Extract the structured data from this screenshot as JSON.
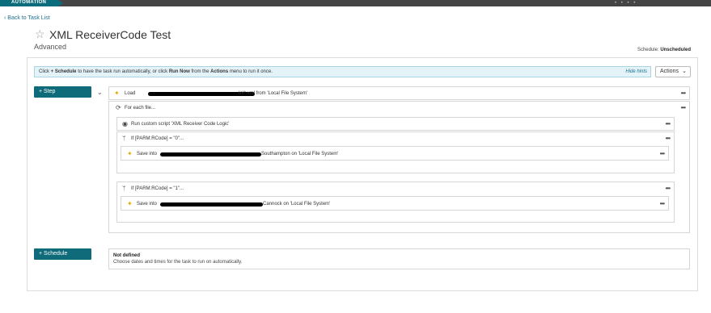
{
  "topbar": {
    "tab_label": "AUTOMATION",
    "right_dots": "• • • •"
  },
  "nav": {
    "back_label": "Back to Task List"
  },
  "task": {
    "title": "XML ReceiverCode Test",
    "subtitle": "Advanced"
  },
  "schedule_status": {
    "label": "Schedule:",
    "value": "Unscheduled"
  },
  "hint": {
    "part1": "Click ",
    "bold1": "+ Schedule",
    "part2": " to have the task run automatically, or click ",
    "bold2": "Run Now",
    "part3": " from the ",
    "bold3": "Actions",
    "part4": " menu to run it once.",
    "hide_label": "Hide hints"
  },
  "actions_button": {
    "label": "Actions"
  },
  "step_button": {
    "label": "+ Step"
  },
  "schedule_button": {
    "label": "+ Schedule"
  },
  "steps": {
    "load": {
      "prefix": "Load",
      "suffix": "In\\*.xml from 'Local File System'"
    },
    "foreach": {
      "label": "For each file..."
    },
    "run_script": {
      "label": "Run custom script 'XML Receiver Code Logic'"
    },
    "if0": {
      "label": "If [PARM:RCode] = \"0\"..."
    },
    "save0": {
      "prefix": "Save into",
      "suffix": "Southampton on 'Local File System'"
    },
    "if1": {
      "label": "If [PARM:RCode] = \"1\"..."
    },
    "save1": {
      "prefix": "Save into",
      "suffix": "Cannock on 'Local File System'"
    },
    "more_label": "•••"
  },
  "schedule_panel": {
    "title": "Not defined",
    "description": "Choose dates and times for the task to run on automatically."
  },
  "icons": {
    "back": "chevron-left-icon",
    "star": "star-outline-icon",
    "load": "arrow-up-icon",
    "loop": "loop-icon",
    "run": "play-circle-icon",
    "branch": "branch-icon",
    "save": "arrow-up-icon",
    "collapse": "chevron-down-icon"
  },
  "colors": {
    "accent": "#0f6a7a",
    "link": "#1f6f8b",
    "hint_bg": "#e3f3f8",
    "topbar": "#454545",
    "load_icon": "#e2a900"
  }
}
